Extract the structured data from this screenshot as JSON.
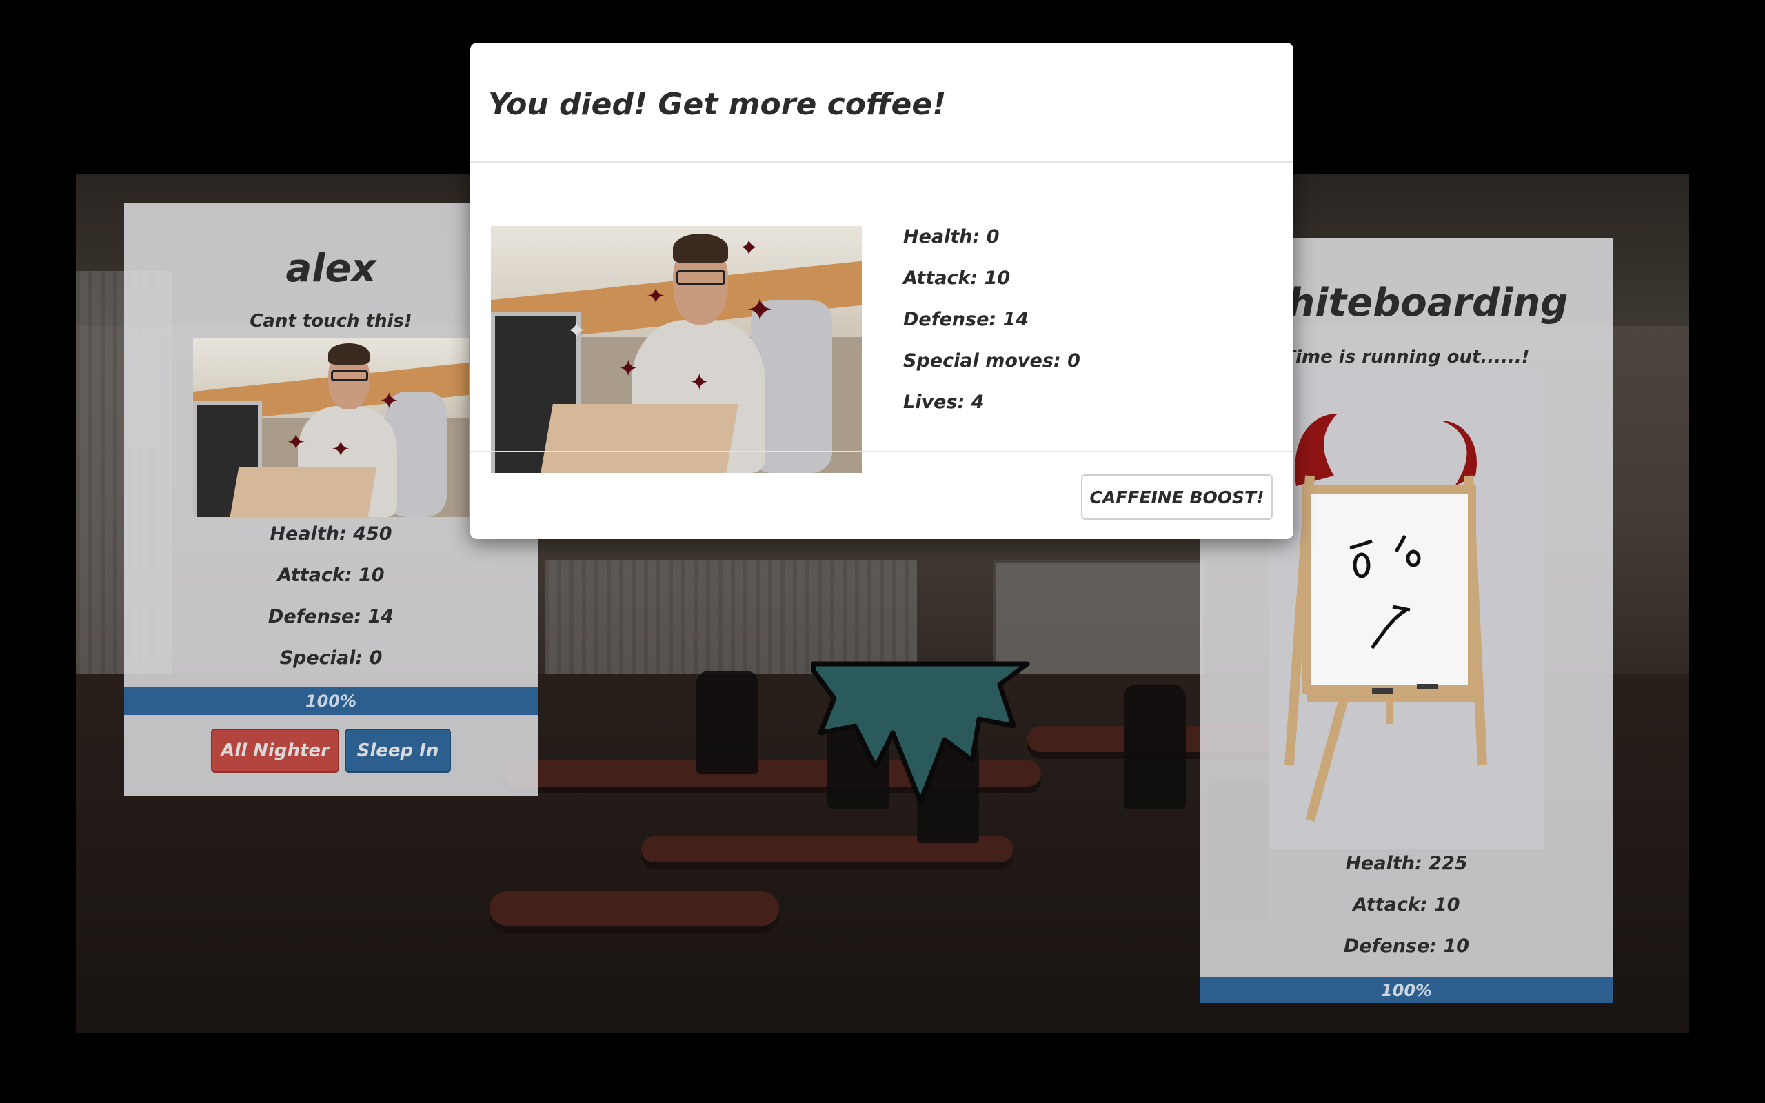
{
  "modal": {
    "title": "You died! Get more coffee!",
    "stats": [
      "Health: 0",
      "Attack: 10",
      "Defense: 14",
      "Special moves: 0",
      "Lives: 4"
    ],
    "button_label": "CAFFEINE BOOST!"
  },
  "player": {
    "name": "alex",
    "tagline": "Cant touch this!",
    "stats": [
      "Health: 450",
      "Attack: 10",
      "Defense: 14",
      "Special: 0"
    ],
    "progress_label": "100%",
    "progress_fraction": 1.0,
    "actions": [
      "All Nighter",
      "Sleep In"
    ]
  },
  "enemy": {
    "name": "Whiteboarding",
    "tagline": "Time is running out......!",
    "stats": [
      "Health: 225",
      "Attack: 10",
      "Defense: 10"
    ],
    "progress_label": "100%",
    "progress_fraction": 1.0
  },
  "colors": {
    "accent_blue": "#2d5f8e",
    "danger_red": "#b4443e",
    "monster_teal": "#4fa5a8",
    "horn_red": "#8e1414"
  }
}
